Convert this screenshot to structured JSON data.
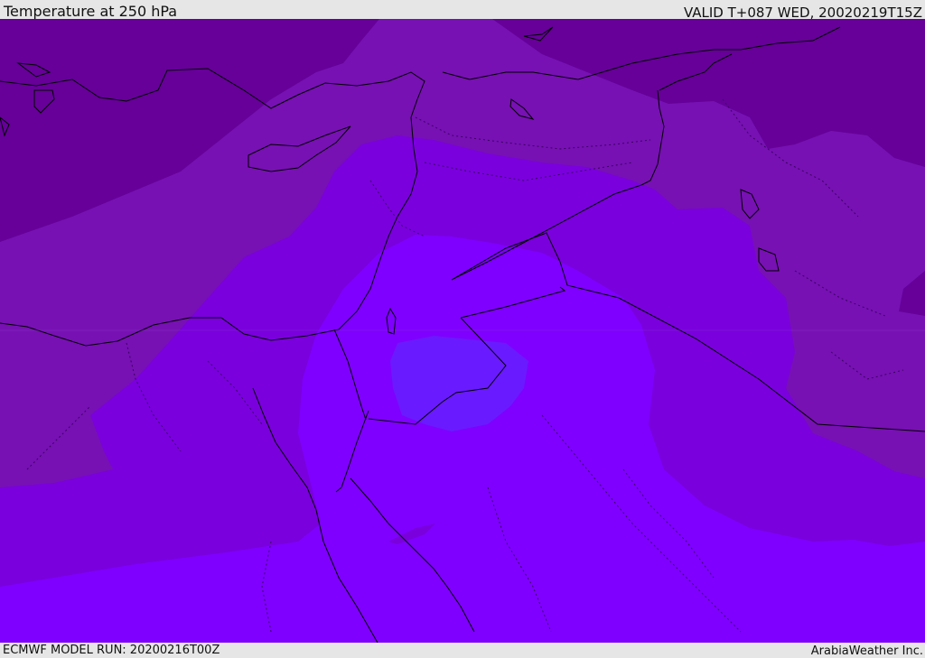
{
  "header": {
    "title": "Temperature at 250 hPa",
    "valid": "VALID T+087 WED, 20020219T15Z"
  },
  "footer": {
    "model_run": "ECMWF MODEL RUN: 20200216T00Z",
    "credit": "ArabiaWeather Inc."
  },
  "colors": {
    "frame": "#e6e6e6",
    "band_coldest": "#660099",
    "band_cold": "#7711b3",
    "band_mid": "#7a00dd",
    "band_warm": "#7f00ff",
    "band_warmest": "#6a1aff",
    "coastline": "#000000",
    "border_dotted": "#3a0060"
  }
}
